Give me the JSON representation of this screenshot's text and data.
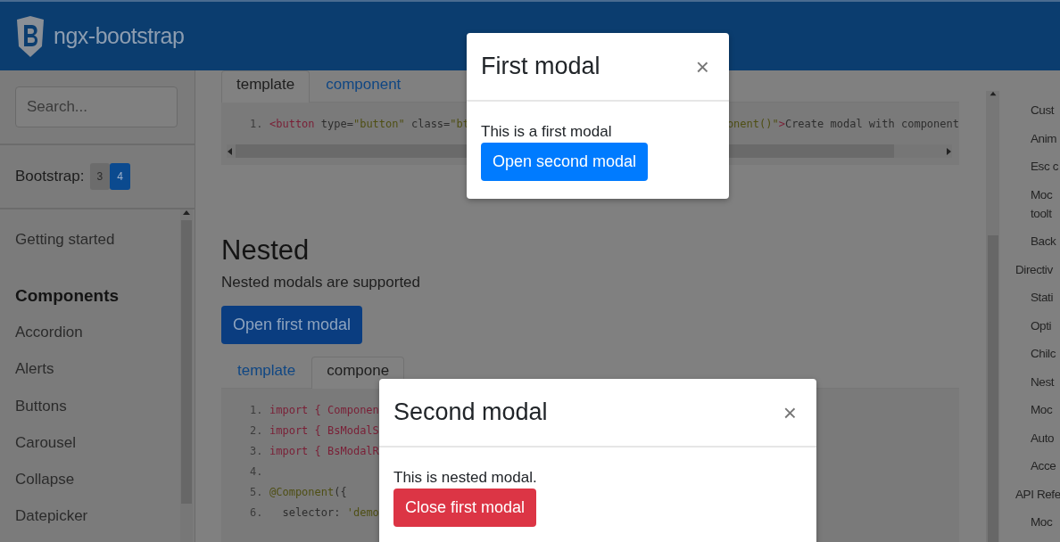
{
  "header": {
    "brand": "ngx-bootstrap"
  },
  "sidebar": {
    "search": {
      "placeholder": "Search..."
    },
    "bootstrap_label": "Bootstrap:",
    "versions": [
      {
        "label": "3",
        "selected": false
      },
      {
        "label": "4",
        "selected": true
      }
    ],
    "items": [
      {
        "label": "Getting started",
        "kind": "link"
      },
      {
        "label": "Components",
        "kind": "heading"
      },
      {
        "label": "Accordion",
        "kind": "link"
      },
      {
        "label": "Alerts",
        "kind": "link"
      },
      {
        "label": "Buttons",
        "kind": "link"
      },
      {
        "label": "Carousel",
        "kind": "link"
      },
      {
        "label": "Collapse",
        "kind": "link"
      },
      {
        "label": "Datepicker",
        "kind": "link"
      }
    ]
  },
  "top_example": {
    "tabs": [
      {
        "label": "template",
        "selected": true
      },
      {
        "label": "component",
        "selected": false
      }
    ],
    "code_lines": [
      {
        "number": "1.",
        "left": [
          {
            "t": "<button",
            "kind": "tag"
          },
          {
            "t": " type=",
            "kind": "attr"
          },
          {
            "t": "\"button\"",
            "kind": "str"
          },
          {
            "t": " class=",
            "kind": "attr"
          },
          {
            "t": "\"bt",
            "kind": "str"
          }
        ],
        "right": [
          {
            "t": "onent()\"",
            "kind": "str"
          },
          {
            "t": ">",
            "kind": "tag"
          },
          {
            "t": "Create modal with component",
            "kind": "plain"
          }
        ]
      }
    ]
  },
  "nested": {
    "title": "Nested",
    "description": "Nested modals are supported",
    "button": "Open first modal",
    "tabs": [
      {
        "label": "template",
        "selected": false
      },
      {
        "label": "compone",
        "selected": true
      }
    ],
    "code_lines": [
      {
        "number": "1.",
        "left": [
          {
            "t": "import { Componen",
            "kind": "tag"
          }
        ]
      },
      {
        "number": "2.",
        "left": [
          {
            "t": "import { BsModalS",
            "kind": "tag"
          }
        ]
      },
      {
        "number": "3.",
        "left": [
          {
            "t": "import { BsModalR",
            "kind": "tag"
          }
        ]
      },
      {
        "number": "4."
      },
      {
        "number": "5.",
        "left": [
          {
            "t": "@Component",
            "kind": "str"
          },
          {
            "t": "({",
            "kind": "attr"
          }
        ]
      },
      {
        "number": "6.",
        "left": [
          {
            "t": "  selector: ",
            "kind": "attr"
          },
          {
            "t": "'demo",
            "kind": "str"
          }
        ]
      }
    ]
  },
  "right_nav": {
    "items": [
      {
        "label": "Cust",
        "kind": "sub"
      },
      {
        "label": "Anim",
        "kind": "sub"
      },
      {
        "label": "Esc c",
        "kind": "sub"
      },
      {
        "label": "Moc\ntoolt",
        "kind": "sub"
      },
      {
        "label": "Back",
        "kind": "sub"
      },
      {
        "label": "Directiv",
        "kind": "section"
      },
      {
        "label": "Stati",
        "kind": "sub"
      },
      {
        "label": "Opti",
        "kind": "sub"
      },
      {
        "label": "Chilc",
        "kind": "sub"
      },
      {
        "label": "Nest",
        "kind": "sub"
      },
      {
        "label": "Moc",
        "kind": "sub"
      },
      {
        "label": "Auto",
        "kind": "sub"
      },
      {
        "label": "Acce",
        "kind": "sub"
      },
      {
        "label": "API Refe",
        "kind": "section"
      },
      {
        "label": "Moc",
        "kind": "sub"
      }
    ]
  },
  "modals": [
    {
      "title": "First modal",
      "close": "×",
      "body": "This is a first modal",
      "button": {
        "label": "Open second modal",
        "kind": "primary"
      }
    },
    {
      "title": "Second modal",
      "close": "×",
      "body": "This is nested modal.",
      "button": {
        "label": "Close first modal",
        "kind": "danger"
      }
    }
  ]
}
